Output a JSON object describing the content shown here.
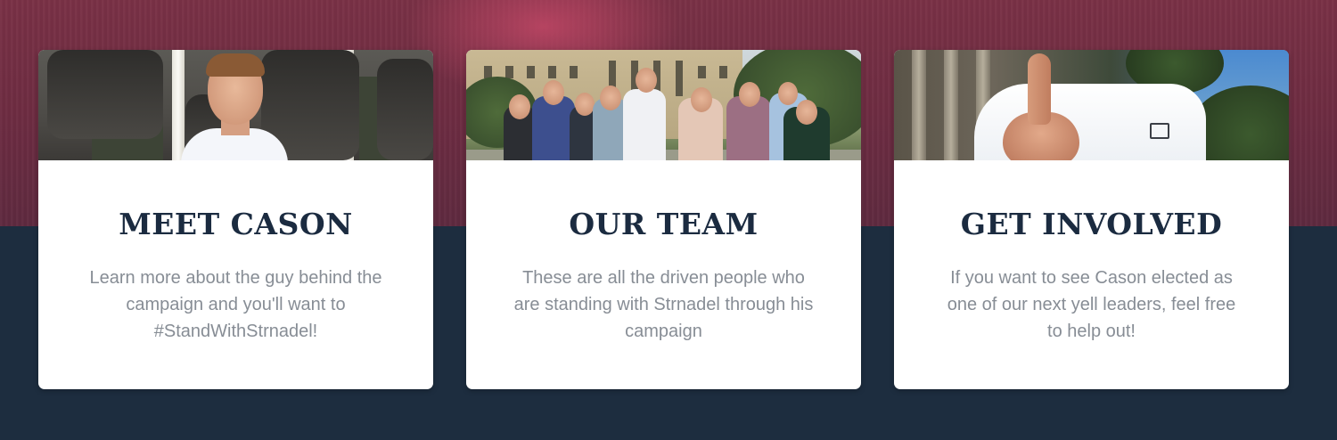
{
  "cards": [
    {
      "title": "MEET CASON",
      "text": "Learn more about the guy behind the campaign and you'll want to #StandWithStrnadel!"
    },
    {
      "title": "OUR TEAM",
      "text": "These are all the driven people who are standing with Strnadel through his campaign"
    },
    {
      "title": "GET INVOLVED",
      "text": "If you want to see Cason elected as one of our next yell leaders, feel free to help out!"
    }
  ]
}
